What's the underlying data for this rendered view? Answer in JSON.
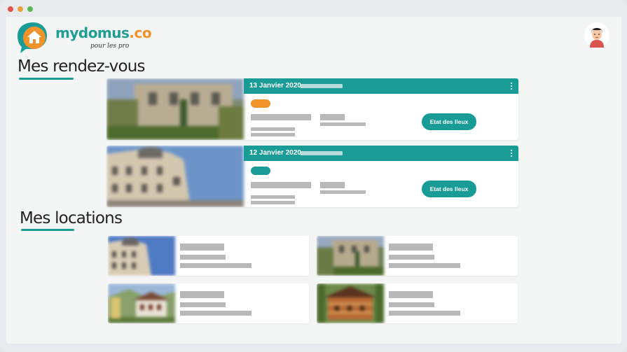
{
  "window": {
    "dot_colors": [
      "#e5534b",
      "#e9a23b",
      "#5cb85c"
    ]
  },
  "brand": {
    "name_part1": "mydomus",
    "name_part2": ".co",
    "tagline": "pour les pro",
    "teal": "#1a9c96",
    "orange": "#f0932b"
  },
  "header": {
    "avatar_icon": "user-avatar-icon"
  },
  "sections": {
    "appointments_title": "Mes rendez-vous",
    "locations_title": "Mes locations"
  },
  "appointments": [
    {
      "date": "13 Janvier 2020",
      "status_color": "#f0932b",
      "action_label": "Etat des lieux",
      "image": "house-stone-photo"
    },
    {
      "date": "12 Janvier 2020",
      "status_color": "#1a9c96",
      "action_label": "Etat des lieux",
      "image": "parisian-building-photo"
    }
  ],
  "locations": [
    {
      "image": "parisian-building-photo"
    },
    {
      "image": "stone-house-garden-photo"
    },
    {
      "image": "alpine-chalet-photo"
    },
    {
      "image": "wooden-chalet-photo"
    }
  ]
}
